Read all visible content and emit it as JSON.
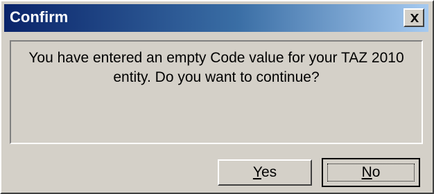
{
  "window": {
    "title": "Confirm",
    "close_glyph": "×"
  },
  "message": {
    "line1": "You have entered an empty Code value for your TAZ 2010",
    "line2": "entity.  Do you want to continue?"
  },
  "buttons": {
    "yes": {
      "mnemonic": "Y",
      "rest": "es"
    },
    "no": {
      "mnemonic": "N",
      "rest": "o"
    }
  },
  "colors": {
    "titlebar_start": "#0a246a",
    "titlebar_end": "#a6caf0",
    "face": "#d4d0c8"
  }
}
